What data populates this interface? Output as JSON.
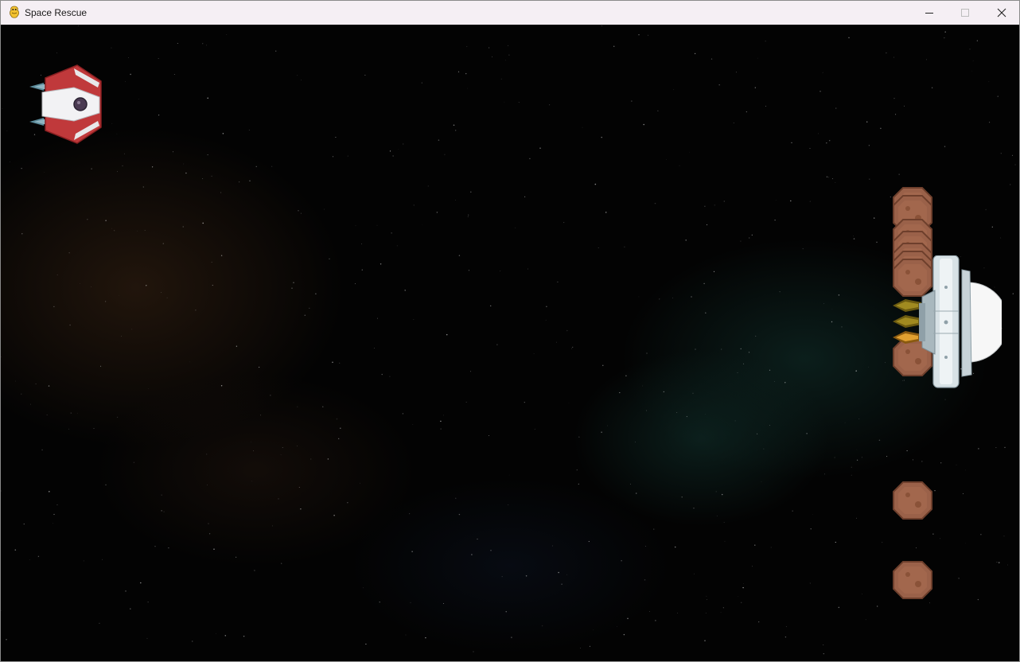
{
  "window": {
    "title": "Space Rescue",
    "app_icon": "pygame-snake-icon",
    "controls": [
      "minimize-icon",
      "maximize-icon",
      "close-icon"
    ]
  },
  "colors": {
    "titlebar": "#f5eff4",
    "space": "#030303",
    "nebula_warm": "#3a2413",
    "nebula_teal": "#0f2a26",
    "asteroid": "#9a6149",
    "player_ship_red": "#c0393b",
    "enemy_ship_hull": "#c8d3d8"
  },
  "game": {
    "sprites": {
      "player_ship": "red-white-spaceship",
      "enemy_ship": "silver-saucer-spaceship",
      "asteroid": "brown-asteroid",
      "thruster_flame": "yellow-thruster-flame"
    }
  }
}
